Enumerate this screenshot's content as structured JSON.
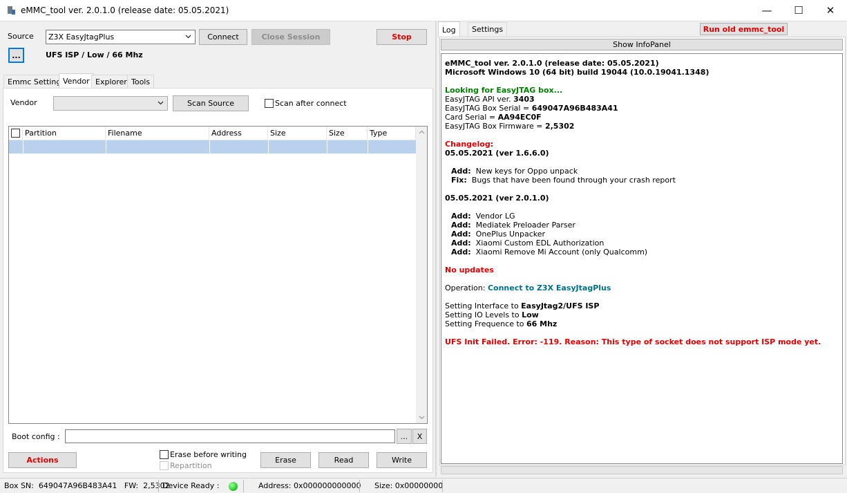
{
  "window": {
    "title": "eMMC_tool ver. 2.0.1.0 (release date: 05.05.2021)"
  },
  "source": {
    "label": "Source",
    "value": "Z3X EasyJtagPlus",
    "connect": "Connect",
    "close_session": "Close Session",
    "stop": "Stop",
    "browse": "...",
    "info": "UFS ISP / Low / 66 Mhz"
  },
  "tabs": [
    "Emmc Settings",
    "Vendor",
    "Explorer",
    "Tools"
  ],
  "vendor": {
    "label": "Vendor",
    "value": "",
    "scan_source": "Scan Source",
    "scan_after_connect": "Scan after connect"
  },
  "grid": {
    "columns": [
      "Partition",
      "Filename",
      "Address",
      "Size",
      "Size",
      "Type"
    ]
  },
  "boot": {
    "label": "Boot config  :",
    "value": "",
    "browse": "...",
    "clear": "X"
  },
  "actions": {
    "actions": "Actions",
    "erase_before_writing": "Erase before writing",
    "repartition": "Repartition",
    "erase": "Erase",
    "read": "Read",
    "write": "Write"
  },
  "right": {
    "tabs": [
      "Log",
      "Settings"
    ],
    "run_old": "Run old emmc_tool",
    "show_info": "Show InfoPanel"
  },
  "log": {
    "l1": "eMMC_tool ver. 2.0.1.0 (release date: 05.05.2021)",
    "l2": "Microsoft Windows 10 (64 bit) build 19044 (10.0.19041.1348)",
    "l3": "Looking for EasyJTAG box...",
    "l4a": "EasyJTAG API ver. ",
    "l4b": "3403",
    "l5a": "EasyJTAG Box Serial = ",
    "l5b": "649047A96B483A41",
    "l6a": "Card Serial = ",
    "l6b": "AA94EC0F",
    "l7a": "EasyJTAG Box Firmware = ",
    "l7b": "2,5302",
    "l8": "Changelog:",
    "l9": "05.05.2021 (ver 1.6.6.0)",
    "l10a": "Add:",
    "l10b": "New keys for Oppo unpack",
    "l11a": "Fix:",
    "l11b": "Bugs that have been found through your crash report",
    "l12": "05.05.2021 (ver 2.0.1.0)",
    "add": [
      "Vendor LG",
      "Mediatek Preloader Parser",
      "OnePlus Unpacker",
      "Xiaomi Custom EDL Authorization",
      "Xiaomi Remove Mi Account (only Qualcomm)"
    ],
    "add_label": "Add:",
    "l18": "No updates",
    "l19a": "Operation: ",
    "l19b": "Connect to Z3X EasyJtagPlus",
    "l20a": "Setting Interface to ",
    "l20b": "EasyJtag2/UFS ISP",
    "l21a": "Setting IO Levels to ",
    "l21b": "Low",
    "l22a": "Setting Frequence to ",
    "l22b": "66 Mhz",
    "l23": "UFS Init Failed. Error: -119. Reason: This type of socket does not support ISP mode yet."
  },
  "status": {
    "box_sn": "Box SN:  649047A96B483A41   FW:  2,5302",
    "device_ready": "Device Ready :",
    "address": "Address: 0x000000000000",
    "size": "Size: 0x00000000"
  },
  "colors": {
    "accent_red": "#e00000",
    "log_green": "#008000",
    "log_teal": "#00708a",
    "selection": "#bad1ee",
    "status_led": "#2ecc2e"
  }
}
